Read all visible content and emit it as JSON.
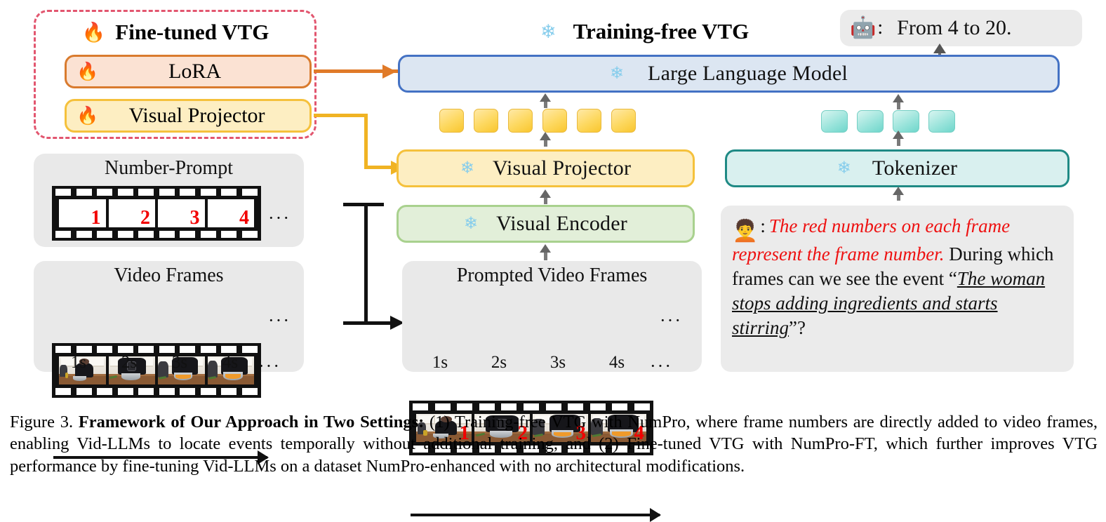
{
  "figure": {
    "caption_label": "Figure 3.",
    "caption_bold": "Framework of Our Approach in Two Settings:",
    "caption_rest": " (1) Training-free VTG with NumPro, where frame numbers are directly added to video frames, enabling Vid-LLMs to locate events temporally without additional training, and (2) Fine-tuned VTG with NumPro-FT, which further improves VTG performance by fine-tuning Vid-LLMs on a dataset NumPro-enhanced with no architectural modifications."
  },
  "finetuned": {
    "title": "Fine-tuned VTG",
    "fire_icon": "fire-icon",
    "lora_label": "LoRA",
    "projector_label": "Visual Projector"
  },
  "trainingfree": {
    "title": "Training-free VTG",
    "snowflake_icon": "snowflake-icon"
  },
  "answer": {
    "robot_icon": "robot-avatar-icon",
    "separator": ":",
    "text": "From 4 to 20."
  },
  "pipeline": {
    "llm_label": "Large Language Model",
    "visual_projector_label": "Visual Projector",
    "visual_encoder_label": "Visual Encoder",
    "tokenizer_label": "Tokenizer",
    "visual_tokens_count": 6,
    "text_tokens_count": 4
  },
  "number_prompt": {
    "title": "Number-Prompt",
    "numbers": [
      "1",
      "2",
      "3",
      "4"
    ],
    "ellipsis": "···"
  },
  "video_frames": {
    "title": "Video Frames",
    "timestamps": [
      "1s",
      "2s",
      "3s",
      "4s"
    ],
    "ellipsis": "···",
    "axis_ellipsis": "···"
  },
  "prompted_frames": {
    "title": "Prompted Video Frames",
    "numbers": [
      "1",
      "2",
      "3",
      "4"
    ],
    "timestamps": [
      "1s",
      "2s",
      "3s",
      "4s"
    ],
    "ellipsis": "···",
    "axis_ellipsis": "···"
  },
  "question": {
    "avatar_icon": "user-avatar-icon",
    "separator": ":",
    "red_instruction": "The red numbers on each frame represent the frame number.",
    "black_part1": "During which frames can we see the event “",
    "underlined_event": "The woman stops adding ingredients and starts stirring",
    "black_part2": "”?"
  },
  "colors": {
    "dashed_border": "#e2566f",
    "lora_border": "#d97b2e",
    "projector_border": "#f5c13c",
    "llm_border": "#4472c4",
    "encoder_border": "#a9d18e",
    "tokenizer_border": "#1f8a85",
    "number_red": "#f20000",
    "snowflake_blue": "#86cdec"
  }
}
